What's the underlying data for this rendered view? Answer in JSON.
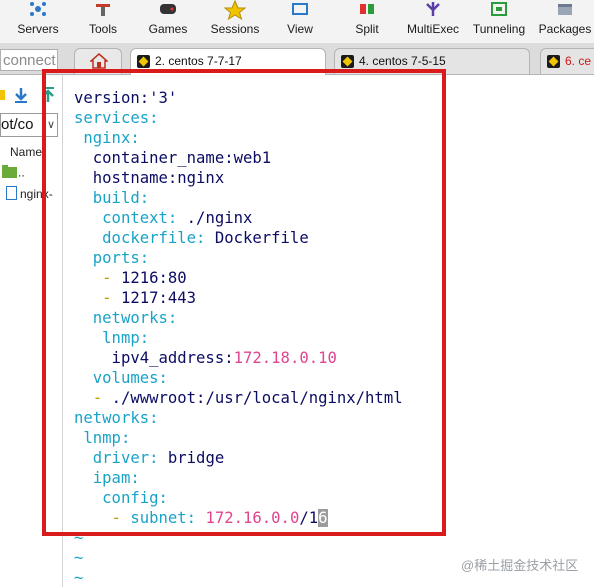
{
  "toolbar": {
    "items": [
      {
        "label": "Servers",
        "icon": "servers-icon"
      },
      {
        "label": "Tools",
        "icon": "tools-icon"
      },
      {
        "label": "Games",
        "icon": "games-icon"
      },
      {
        "label": "Sessions",
        "icon": "sessions-star-icon"
      },
      {
        "label": "View",
        "icon": "view-icon"
      },
      {
        "label": "Split",
        "icon": "split-icon"
      },
      {
        "label": "MultiExec",
        "icon": "multiexec-icon"
      },
      {
        "label": "Tunneling",
        "icon": "tunneling-icon"
      },
      {
        "label": "Packages",
        "icon": "packages-icon"
      }
    ]
  },
  "tabs": {
    "connect_placeholder": "connect",
    "items": [
      {
        "label": "2. centos 7-7-17",
        "active": true
      },
      {
        "label": "4. centos 7-5-15",
        "active": false
      },
      {
        "label": "6. ce",
        "active": false
      }
    ]
  },
  "sftp": {
    "path": "ot/co",
    "column_name": "Name",
    "rows": [
      {
        "label": ".."
      },
      {
        "label": "nginx-"
      }
    ]
  },
  "editor": {
    "lines": [
      {
        "segments": [
          {
            "text": "version:'3'",
            "cls": "v"
          }
        ]
      },
      {
        "segments": [
          {
            "text": "services:",
            "cls": "k"
          }
        ]
      },
      {
        "segments": [
          {
            "text": " nginx:",
            "cls": "k"
          }
        ]
      },
      {
        "segments": [
          {
            "text": "  container_name:web1",
            "cls": "v"
          }
        ]
      },
      {
        "segments": [
          {
            "text": "  hostname:nginx",
            "cls": "v"
          }
        ]
      },
      {
        "segments": [
          {
            "text": "  build:",
            "cls": "k"
          }
        ]
      },
      {
        "segments": [
          {
            "text": "   context:",
            "cls": "k"
          },
          {
            "text": " ./nginx",
            "cls": "v"
          }
        ]
      },
      {
        "segments": [
          {
            "text": "   dockerfile:",
            "cls": "k"
          },
          {
            "text": " Dockerfile",
            "cls": "v"
          }
        ]
      },
      {
        "segments": [
          {
            "text": "  ports:",
            "cls": "k"
          }
        ]
      },
      {
        "segments": [
          {
            "text": "   - ",
            "cls": "dash"
          },
          {
            "text": "1216:80",
            "cls": "v"
          }
        ]
      },
      {
        "segments": [
          {
            "text": "   - ",
            "cls": "dash"
          },
          {
            "text": "1217:443",
            "cls": "v"
          }
        ]
      },
      {
        "segments": [
          {
            "text": "  networks:",
            "cls": "k"
          }
        ]
      },
      {
        "segments": [
          {
            "text": "   lnmp:",
            "cls": "k"
          }
        ]
      },
      {
        "segments": [
          {
            "text": "    ipv4_address:",
            "cls": "v"
          },
          {
            "text": "172.18.0.10",
            "cls": "d"
          }
        ]
      },
      {
        "segments": [
          {
            "text": "  volumes:",
            "cls": "k"
          }
        ]
      },
      {
        "segments": [
          {
            "text": "  - ",
            "cls": "dash"
          },
          {
            "text": "./wwwroot:/usr/local/nginx/html",
            "cls": "v"
          }
        ]
      },
      {
        "segments": [
          {
            "text": "networks:",
            "cls": "k"
          }
        ]
      },
      {
        "segments": [
          {
            "text": " lnmp:",
            "cls": "k"
          }
        ]
      },
      {
        "segments": [
          {
            "text": "  driver:",
            "cls": "k"
          },
          {
            "text": " bridge",
            "cls": "v"
          }
        ]
      },
      {
        "segments": [
          {
            "text": "  ipam:",
            "cls": "k"
          }
        ]
      },
      {
        "segments": [
          {
            "text": "   config:",
            "cls": "k"
          }
        ]
      },
      {
        "segments": [
          {
            "text": "    - ",
            "cls": "dash"
          },
          {
            "text": "subnet:",
            "cls": "k"
          },
          {
            "text": " 172.16.0.0",
            "cls": "d"
          },
          {
            "text": "/1",
            "cls": "v"
          },
          {
            "text": "6",
            "cls": "cursor"
          }
        ]
      },
      {
        "segments": [
          {
            "text": "~",
            "cls": "tilde"
          }
        ]
      },
      {
        "segments": [
          {
            "text": "~",
            "cls": "tilde"
          }
        ]
      },
      {
        "segments": [
          {
            "text": "~",
            "cls": "tilde"
          }
        ]
      }
    ]
  },
  "watermark": "@稀土掘金技术社区",
  "colors": {
    "highlight_border": "#d91b1b",
    "yaml_key": "#1aa3c8",
    "yaml_value": "#0c0c64",
    "yaml_number": "#e0458f"
  }
}
